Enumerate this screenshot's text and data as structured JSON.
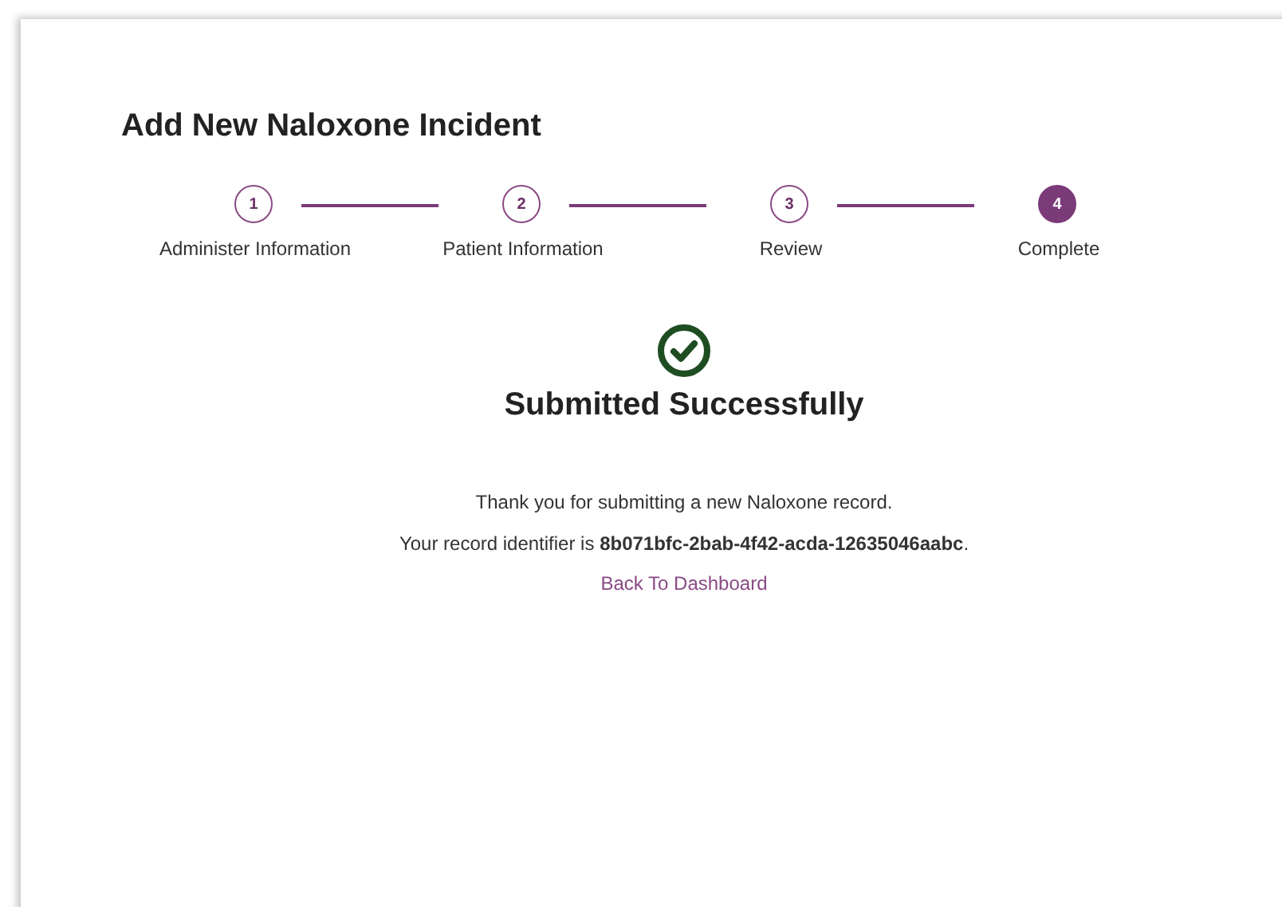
{
  "title": "Add New Naloxone Incident",
  "steps": [
    {
      "number": "1",
      "label": "Administer Information",
      "selected": false
    },
    {
      "number": "2",
      "label": "Patient Information",
      "selected": false
    },
    {
      "number": "3",
      "label": "Review",
      "selected": false
    },
    {
      "number": "4",
      "label": "Complete",
      "selected": true
    }
  ],
  "result": {
    "heading": "Submitted Successfully",
    "message": "Thank you for submitting a new Naloxone record.",
    "identifier_text": "Your record identifier is **8b071bfc-2bab-4f42-acda-12635046aabc**.",
    "link": "Back To Dashboard"
  }
}
